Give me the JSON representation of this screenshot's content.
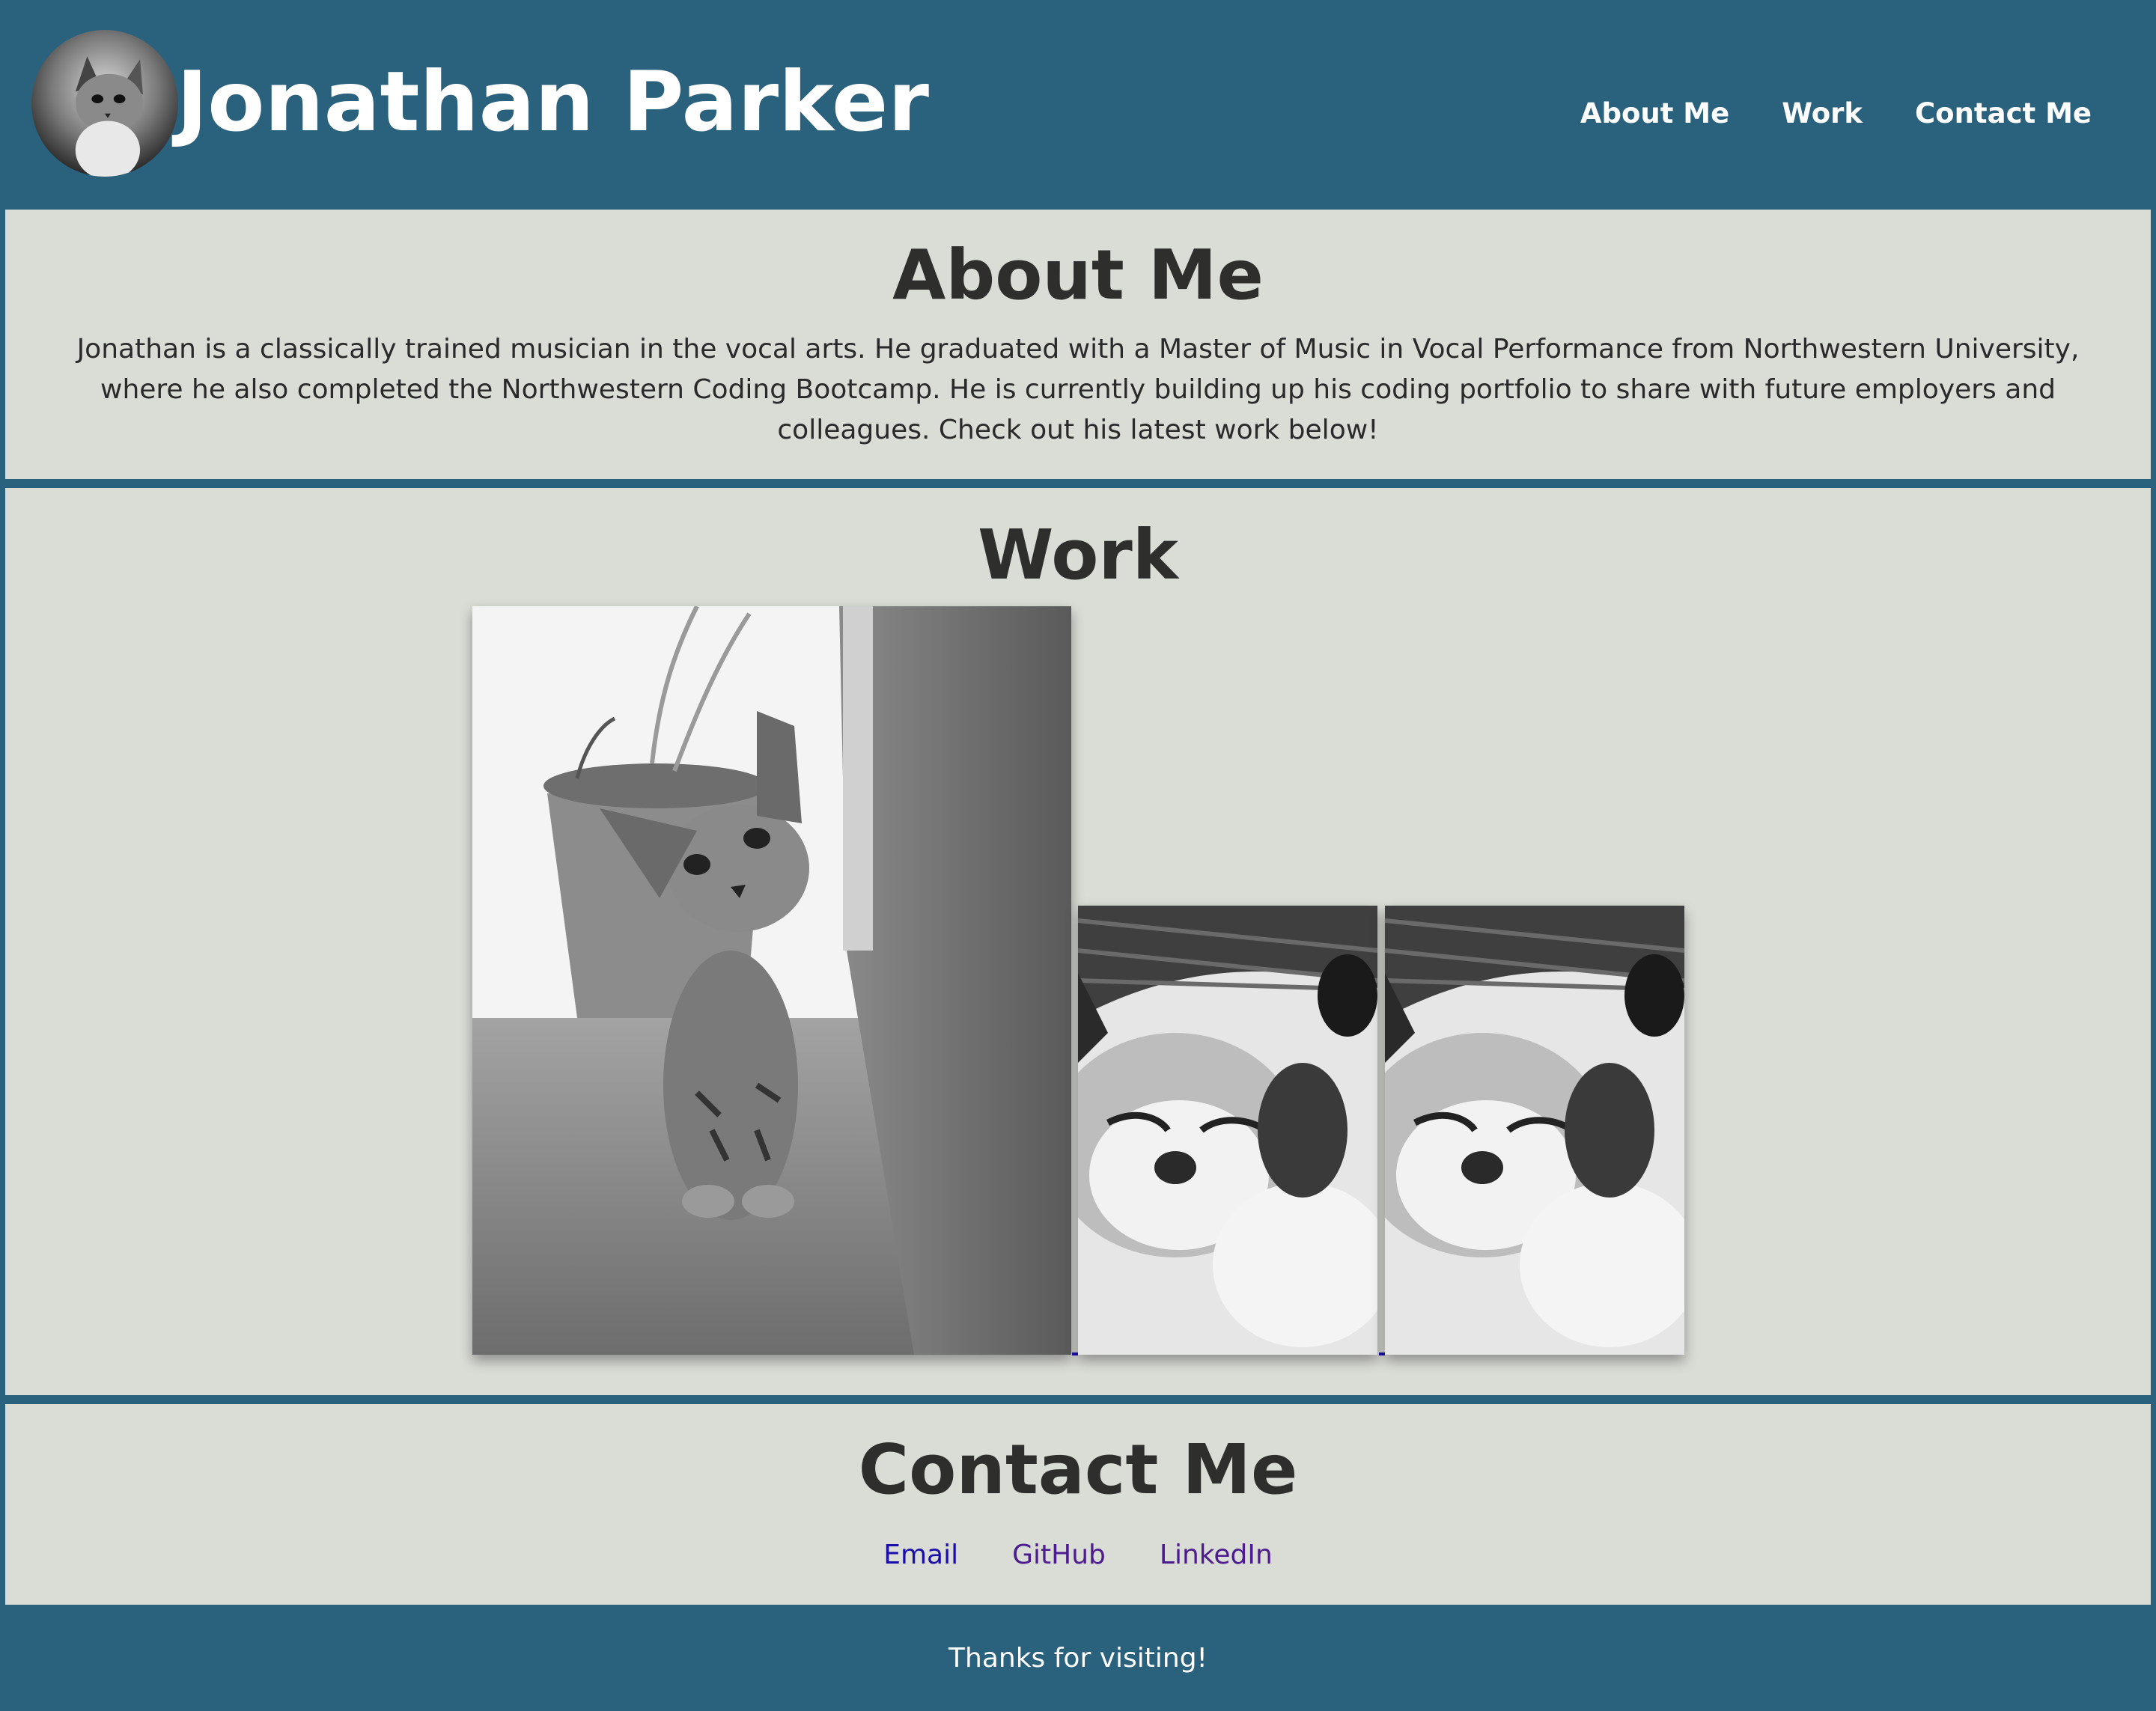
{
  "header": {
    "title": "Jonathan Parker",
    "avatar_icon": "kitten-avatar-icon",
    "nav": [
      "About Me",
      "Work",
      "Contact Me"
    ]
  },
  "about": {
    "heading": "About Me",
    "text": "Jonathan is a classically trained musician in the vocal arts. He graduated with a Master of Music in Vocal Performance from Northwestern University, where he also completed the Northwestern Coding Bootcamp. He is currently building up his coding portfolio to share with future employers and colleagues. Check out his latest work below!"
  },
  "work": {
    "heading": "Work",
    "images": [
      "sitting-kitten-photo",
      "sleeping-kitten-photo",
      "sleeping-kitten-photo"
    ]
  },
  "contact": {
    "heading": "Contact Me",
    "links": [
      "Email",
      "GitHub",
      "LinkedIn"
    ]
  },
  "footer": {
    "text": "Thanks for visiting!"
  },
  "colors": {
    "header_bg": "#2a627e",
    "section_bg": "#dadcd6",
    "heading": "#2e2e2c",
    "link": "#1a0dab",
    "visited_link": "#4b1b8f"
  }
}
